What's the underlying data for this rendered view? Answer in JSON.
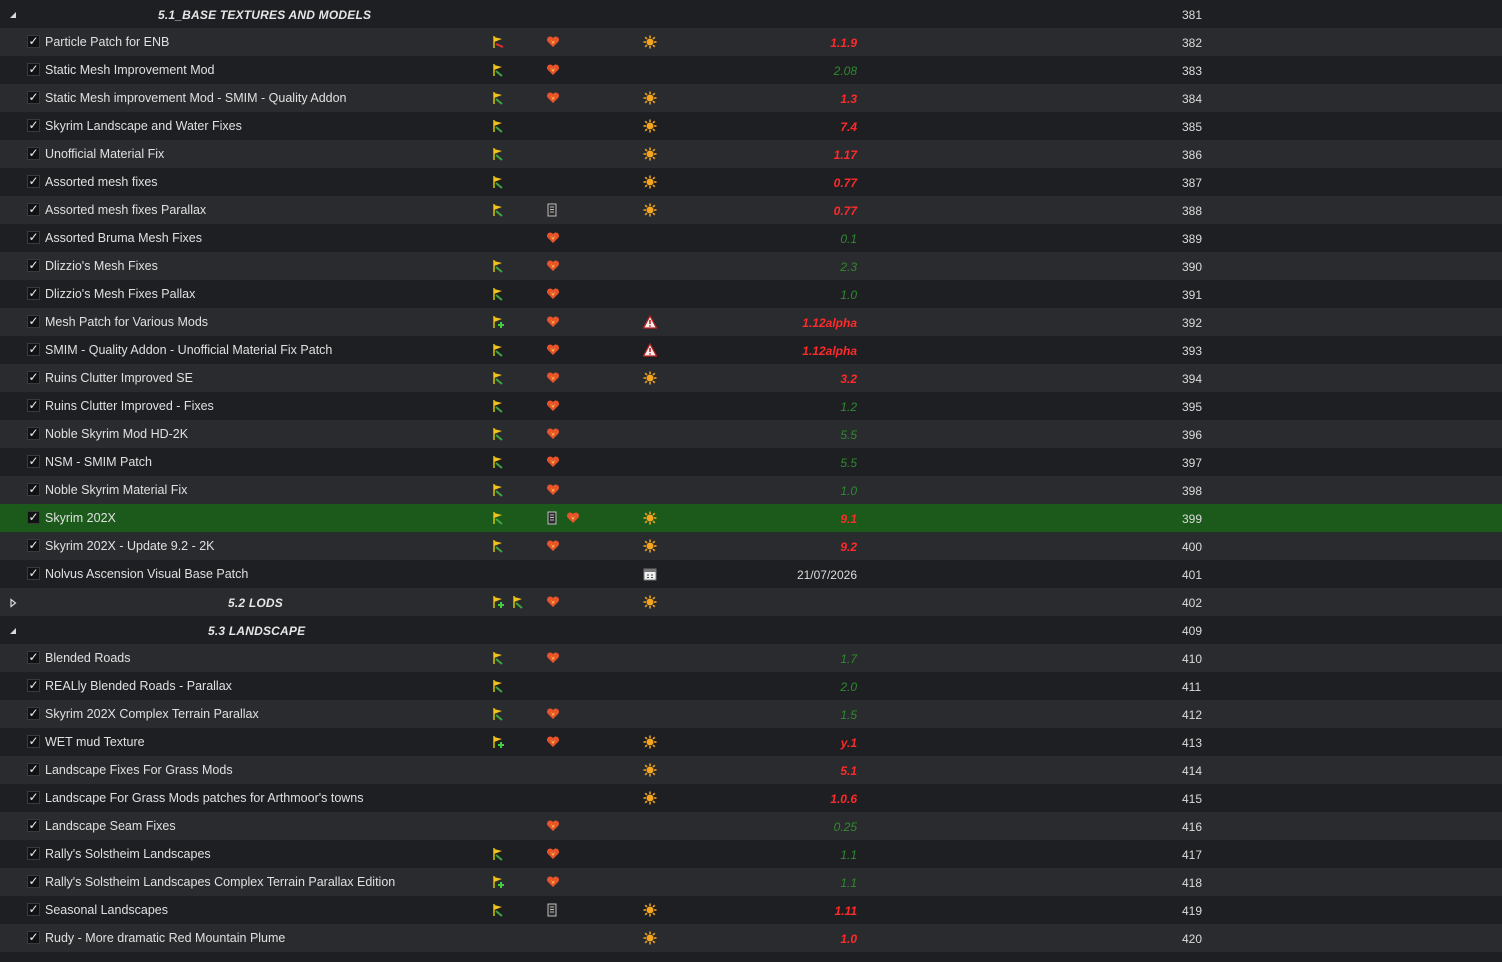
{
  "colors": {
    "row_even": "#2a2b2e",
    "row_odd": "#1e1f22",
    "row_selected": "#1c5a1c",
    "version_outdated": "#ff2a2a",
    "version_current": "#2f8a2f"
  },
  "rows": [
    {
      "type": "separator",
      "expanded": true,
      "name": "5.1_BASE TEXTURES AND MODELS",
      "priority": "381",
      "icons": []
    },
    {
      "type": "mod",
      "checked": true,
      "name": "Particle Patch for ENB",
      "version": "1.1.9",
      "version_state": "outdated",
      "priority": "382",
      "icons": [
        "flag-red-icon",
        "conflict-heart-icon",
        "update-sun-icon"
      ]
    },
    {
      "type": "mod",
      "checked": true,
      "name": "Static Mesh Improvement Mod",
      "version": "2.08",
      "version_state": "current",
      "priority": "383",
      "icons": [
        "flag-icon",
        "conflict-heart-icon"
      ]
    },
    {
      "type": "mod",
      "checked": true,
      "name": "Static Mesh improvement Mod - SMIM - Quality Addon",
      "version": "1.3",
      "version_state": "outdated",
      "priority": "384",
      "icons": [
        "flag-icon",
        "conflict-heart-icon",
        "update-sun-icon"
      ]
    },
    {
      "type": "mod",
      "checked": true,
      "name": "Skyrim Landscape and Water Fixes",
      "version": "7.4",
      "version_state": "outdated",
      "priority": "385",
      "icons": [
        "flag-icon",
        "update-sun-icon"
      ]
    },
    {
      "type": "mod",
      "checked": true,
      "name": "Unofficial Material Fix",
      "version": "1.17",
      "version_state": "outdated",
      "priority": "386",
      "icons": [
        "flag-icon",
        "update-sun-icon"
      ]
    },
    {
      "type": "mod",
      "checked": true,
      "name": "Assorted mesh fixes",
      "version": "0.77",
      "version_state": "outdated",
      "priority": "387",
      "icons": [
        "flag-icon",
        "update-sun-icon"
      ]
    },
    {
      "type": "mod",
      "checked": true,
      "name": "Assorted mesh fixes Parallax",
      "version": "0.77",
      "version_state": "outdated",
      "priority": "388",
      "icons": [
        "flag-icon",
        "document-icon",
        "update-sun-icon"
      ]
    },
    {
      "type": "mod",
      "checked": true,
      "name": "Assorted Bruma Mesh Fixes",
      "version": "0.1",
      "version_state": "current",
      "priority": "389",
      "icons": [
        "conflict-heart-icon"
      ]
    },
    {
      "type": "mod",
      "checked": true,
      "name": "Dlizzio's Mesh Fixes",
      "version": "2.3",
      "version_state": "current",
      "priority": "390",
      "icons": [
        "flag-icon",
        "conflict-heart-icon"
      ]
    },
    {
      "type": "mod",
      "checked": true,
      "name": "Dlizzio's Mesh Fixes Pallax",
      "version": "1.0",
      "version_state": "current",
      "priority": "391",
      "icons": [
        "flag-icon",
        "conflict-heart-icon"
      ]
    },
    {
      "type": "mod",
      "checked": true,
      "name": "Mesh Patch for Various Mods",
      "version": "1.12alpha",
      "version_state": "outdated",
      "priority": "392",
      "icons": [
        "flag-plus-icon",
        "conflict-heart-icon",
        "warning-icon"
      ]
    },
    {
      "type": "mod",
      "checked": true,
      "name": "SMIM - Quality Addon - Unofficial Material Fix Patch",
      "version": "1.12alpha",
      "version_state": "outdated",
      "priority": "393",
      "icons": [
        "flag-icon",
        "conflict-heart-icon",
        "warning-icon"
      ]
    },
    {
      "type": "mod",
      "checked": true,
      "name": "Ruins Clutter Improved SE",
      "version": "3.2",
      "version_state": "outdated",
      "priority": "394",
      "icons": [
        "flag-icon",
        "conflict-heart-icon",
        "update-sun-icon"
      ]
    },
    {
      "type": "mod",
      "checked": true,
      "name": "Ruins Clutter Improved - Fixes",
      "version": "1.2",
      "version_state": "current",
      "priority": "395",
      "icons": [
        "flag-icon",
        "conflict-heart-icon"
      ]
    },
    {
      "type": "mod",
      "checked": true,
      "name": "Noble Skyrim Mod HD-2K",
      "version": "5.5",
      "version_state": "current",
      "priority": "396",
      "icons": [
        "flag-icon",
        "conflict-heart-icon"
      ]
    },
    {
      "type": "mod",
      "checked": true,
      "name": "NSM - SMIM Patch",
      "version": "5.5",
      "version_state": "current",
      "priority": "397",
      "icons": [
        "flag-icon",
        "conflict-heart-icon"
      ]
    },
    {
      "type": "mod",
      "checked": true,
      "name": "Noble Skyrim Material Fix",
      "version": "1.0",
      "version_state": "current",
      "priority": "398",
      "icons": [
        "flag-icon",
        "conflict-heart-icon"
      ]
    },
    {
      "type": "mod",
      "checked": true,
      "selected": true,
      "name": "Skyrim 202X",
      "version": "9.1",
      "version_state": "outdated",
      "priority": "399",
      "icons": [
        "flag-icon",
        "document-icon",
        "conflict-heart-icon",
        "update-sun-icon"
      ]
    },
    {
      "type": "mod",
      "checked": true,
      "name": "Skyrim 202X - Update 9.2 - 2K",
      "version": "9.2",
      "version_state": "outdated",
      "priority": "400",
      "icons": [
        "flag-icon",
        "conflict-heart-icon",
        "update-sun-icon"
      ]
    },
    {
      "type": "mod",
      "checked": true,
      "name": "Nolvus Ascension Visual Base Patch",
      "version": "21/07/2026",
      "version_state": "date",
      "priority": "401",
      "icons": [
        "calendar-icon"
      ]
    },
    {
      "type": "separator",
      "expanded": false,
      "name": "5.2 LODS",
      "priority": "402",
      "icons": [
        "flag-plus-icon",
        "flag-icon",
        "conflict-heart-icon",
        "update-sun-icon"
      ]
    },
    {
      "type": "separator",
      "expanded": true,
      "name": "5.3 LANDSCAPE",
      "priority": "409",
      "icons": []
    },
    {
      "type": "mod",
      "checked": true,
      "name": "Blended Roads",
      "version": "1.7",
      "version_state": "current",
      "priority": "410",
      "icons": [
        "flag-icon",
        "conflict-heart-icon"
      ]
    },
    {
      "type": "mod",
      "checked": true,
      "name": "REALly Blended Roads - Parallax",
      "version": "2.0",
      "version_state": "current",
      "priority": "411",
      "icons": [
        "flag-icon"
      ]
    },
    {
      "type": "mod",
      "checked": true,
      "name": "Skyrim 202X Complex Terrain Parallax",
      "version": "1.5",
      "version_state": "current",
      "priority": "412",
      "icons": [
        "flag-icon",
        "conflict-heart-icon"
      ]
    },
    {
      "type": "mod",
      "checked": true,
      "name": "WET mud Texture",
      "version": "y.1",
      "version_state": "outdated",
      "priority": "413",
      "icons": [
        "flag-plus-icon",
        "conflict-heart-icon",
        "update-sun-icon"
      ]
    },
    {
      "type": "mod",
      "checked": true,
      "name": "Landscape Fixes For Grass Mods",
      "version": "5.1",
      "version_state": "outdated",
      "priority": "414",
      "icons": [
        "update-sun-icon"
      ]
    },
    {
      "type": "mod",
      "checked": true,
      "name": "Landscape For Grass Mods patches for Arthmoor's towns",
      "version": "1.0.6",
      "version_state": "outdated",
      "priority": "415",
      "icons": [
        "update-sun-icon"
      ]
    },
    {
      "type": "mod",
      "checked": true,
      "name": "Landscape Seam Fixes",
      "version": "0.25",
      "version_state": "current",
      "priority": "416",
      "icons": [
        "conflict-heart-icon"
      ]
    },
    {
      "type": "mod",
      "checked": true,
      "name": "Rally's Solstheim Landscapes",
      "version": "1.1",
      "version_state": "current",
      "priority": "417",
      "icons": [
        "flag-icon",
        "conflict-heart-icon"
      ]
    },
    {
      "type": "mod",
      "checked": true,
      "name": "Rally's Solstheim Landscapes Complex Terrain Parallax Edition",
      "version": "1.1",
      "version_state": "current",
      "priority": "418",
      "icons": [
        "flag-plus-icon",
        "conflict-heart-icon"
      ]
    },
    {
      "type": "mod",
      "checked": true,
      "name": "Seasonal Landscapes",
      "version": "1.11",
      "version_state": "outdated",
      "priority": "419",
      "icons": [
        "flag-icon",
        "document-icon",
        "update-sun-icon"
      ]
    },
    {
      "type": "mod",
      "checked": true,
      "name": "Rudy - More dramatic Red Mountain Plume",
      "version": "1.0",
      "version_state": "outdated",
      "priority": "420",
      "icons": [
        "update-sun-icon"
      ]
    }
  ]
}
